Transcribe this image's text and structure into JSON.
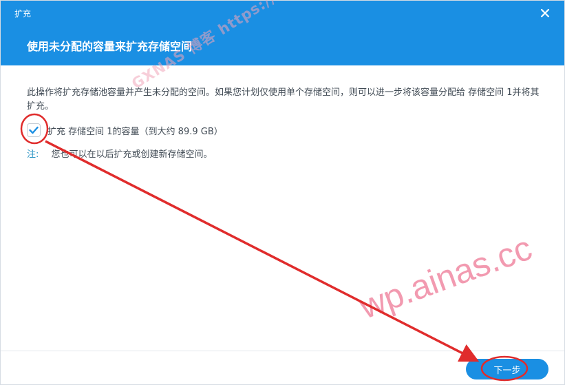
{
  "dialog": {
    "window_title": "扩充",
    "step_title": "使用未分配的容量来扩充存储空间",
    "description": "此操作将扩充存储池容量并产生未分配的空间。如果您计划仅使用单个存储空间，则可以进一步将该容量分配给 存储空间 1并将其扩充。",
    "checkbox": {
      "label": "扩充 存储空间 1的容量（到大约 89.9 GB）",
      "checked": true
    },
    "note": {
      "label": "注:",
      "text": "您也可以在以后扩充或创建新存储空间。"
    },
    "next_button": "下一步"
  },
  "watermarks": {
    "diagonal": "GXNAS 博客 https://wp.gxnas.com",
    "large": "wp.ainas.cc"
  },
  "colors": {
    "header_bg": "#1a8fe3",
    "accent": "#1a8fe3",
    "note_label": "#2a94c4",
    "annotation_red": "#e02c2c"
  },
  "icons": {
    "close": "close-icon",
    "check": "checkmark-icon"
  }
}
